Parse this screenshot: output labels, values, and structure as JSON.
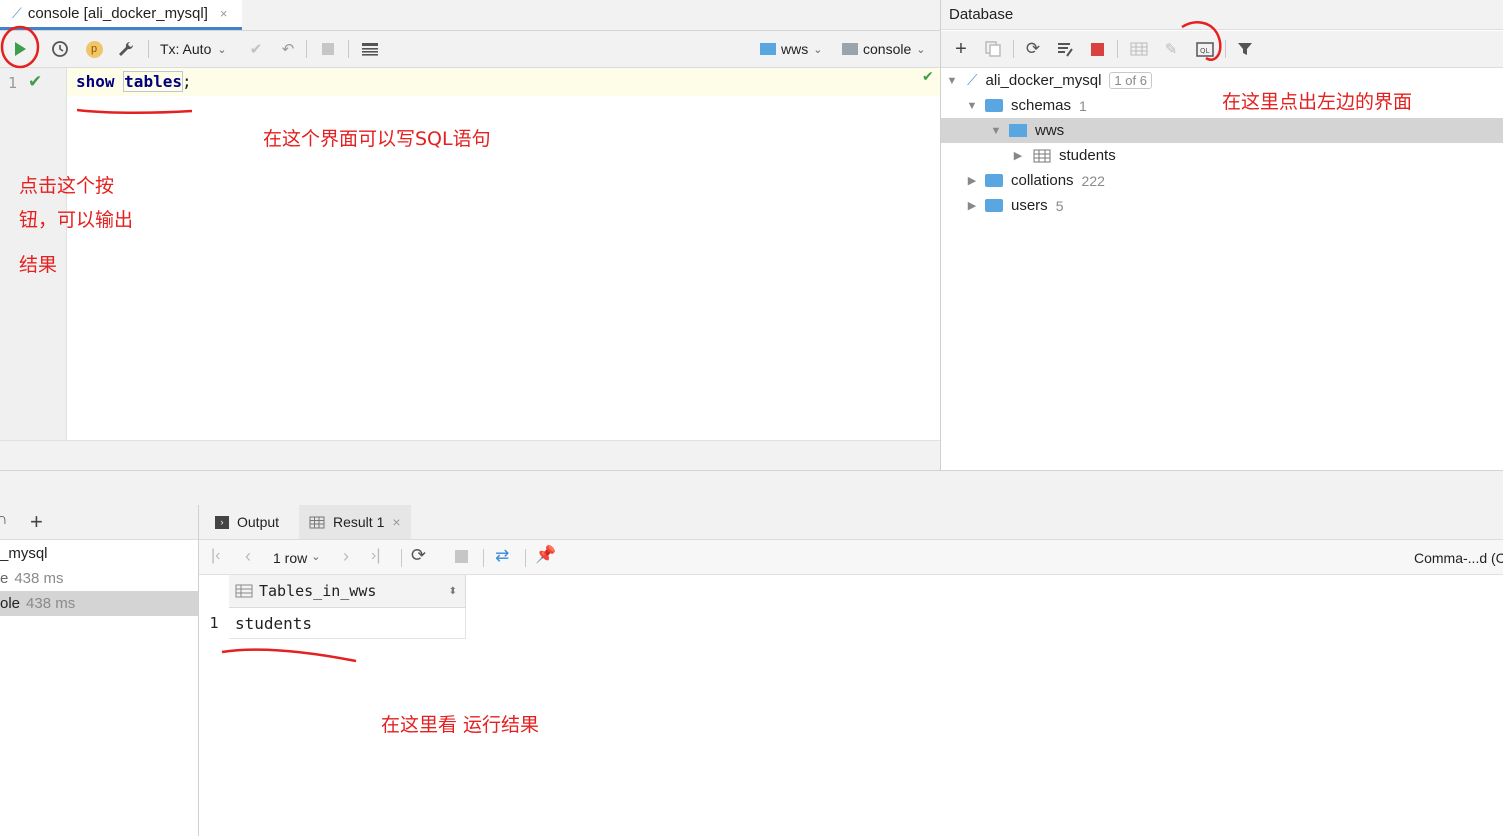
{
  "editor": {
    "tab_title": "console [ali_docker_mysql]",
    "tab_close": "×",
    "tx_mode": "Tx: Auto",
    "schema": "wws",
    "session": "console",
    "line_number": "1",
    "code_keyword": "show",
    "code_name": "tables",
    "code_end": ";"
  },
  "database": {
    "title": "Database",
    "tree": {
      "root": "ali_docker_mysql",
      "root_badge": "1 of 6",
      "schemas": "schemas",
      "schemas_count": "1",
      "schema_wws": "wws",
      "table_students": "students",
      "collations": "collations",
      "collations_count": "222",
      "users": "users",
      "users_count": "5"
    }
  },
  "services": {
    "rows": [
      {
        "label": "_mysql",
        "time": ""
      },
      {
        "label": "e",
        "time": "438 ms"
      },
      {
        "label": "ole",
        "time": "438 ms"
      }
    ]
  },
  "results": {
    "tab_output": "Output",
    "tab_result": "Result 1",
    "tab_close": "×",
    "rows_label": "1 row",
    "right_label": "Comma-...d (C",
    "column": "Tables_in_wws",
    "row_number": "1",
    "cell": "students"
  },
  "annotations": {
    "write_sql": "在这个界面可以写SQL语句",
    "click_button_1": "点击这个按",
    "click_button_2": "钮，可以输出",
    "click_button_3": "结果",
    "open_console": "在这里点出左边的界面",
    "view_result": "在这里看 运行结果"
  },
  "colors": {
    "accent": "#4083c9",
    "run_green": "#3e9e4a",
    "annotation_red": "#e52020",
    "folder_blue": "#5aa6e0",
    "stop_red": "#d94040"
  }
}
